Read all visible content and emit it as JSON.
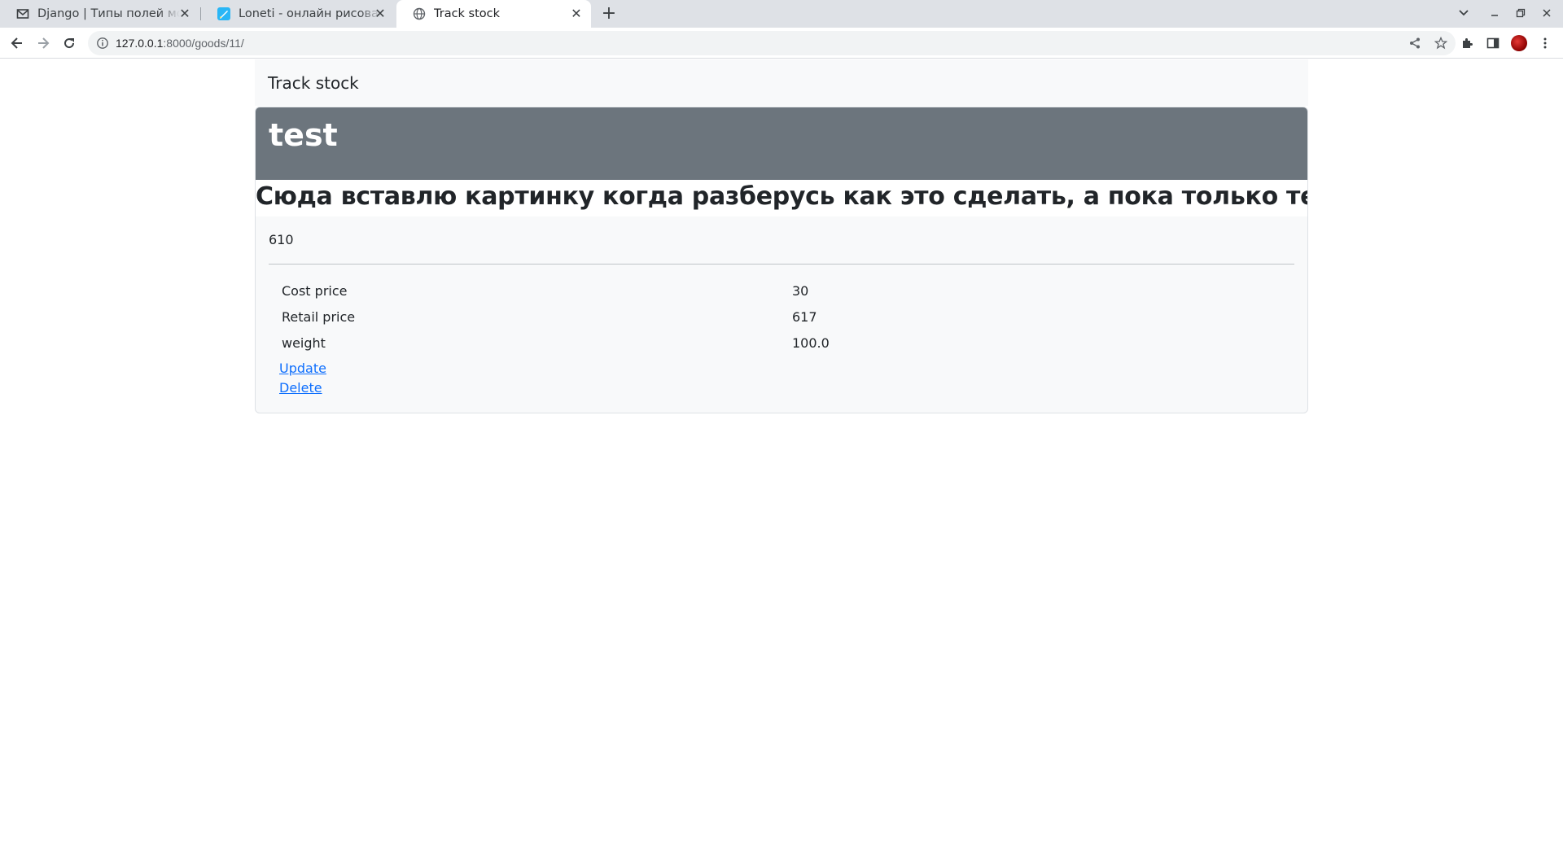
{
  "browser": {
    "tabs": [
      {
        "title": "Django | Типы полей мод",
        "icon": "gmail-icon",
        "active": false
      },
      {
        "title": "Loneti - онлайн рисовалк",
        "icon": "loneti-icon",
        "active": false
      },
      {
        "title": "Track stock",
        "icon": "globe-icon",
        "active": true
      }
    ],
    "address": {
      "host": "127.0.0.1",
      "rest": ":8000/goods/11/"
    }
  },
  "navbar": {
    "brand": "Track stock"
  },
  "product": {
    "name": "test",
    "description": "Сюда вставлю картинку когда разберусь как это сделать, а пока только тест",
    "quantity": "610",
    "attributes": [
      {
        "label": "Cost price",
        "value": "30"
      },
      {
        "label": "Retail price",
        "value": "617"
      },
      {
        "label": "weight",
        "value": "100.0"
      }
    ],
    "actions": {
      "update": "Update",
      "delete": "Delete"
    }
  },
  "colors": {
    "header_bg": "#6c757d",
    "link": "#0d6efd",
    "navbar_bg": "#f8f9fa"
  }
}
